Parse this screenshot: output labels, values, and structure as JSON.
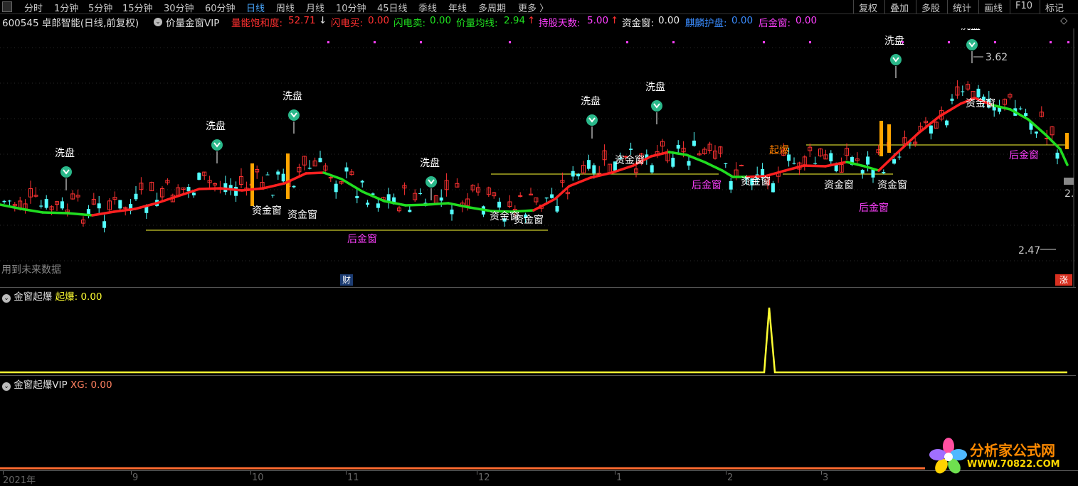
{
  "toolbar": {
    "periods": [
      "分时",
      "1分钟",
      "5分钟",
      "15分钟",
      "30分钟",
      "60分钟",
      "日线",
      "周线",
      "月线",
      "10分钟",
      "45日线",
      "季线",
      "年线",
      "多周期",
      "更多 〉"
    ],
    "active_period": "日线",
    "right_buttons": [
      "复权",
      "叠加",
      "多股",
      "统计",
      "画线",
      "F10",
      "标记"
    ]
  },
  "info_bar": {
    "stock": "600545 卓郎智能(日线,前复权)",
    "indicator": "价量金窗VIP",
    "saturation": {
      "label": "量能饱和度:",
      "value": "52.71",
      "arrow": "↓"
    },
    "flash_buy": {
      "label": "闪电买:",
      "value": "0.00"
    },
    "flash_sell": {
      "label": "闪电卖:",
      "value": "0.00"
    },
    "avg_line": {
      "label": "价量均线:",
      "value": "2.94",
      "arrow": "↑"
    },
    "hold_days": {
      "label": "持股天数:",
      "value": "5.00",
      "arrow": "↑"
    },
    "fund_window": {
      "label": "资金窗:",
      "value": "0.00"
    },
    "qilin": {
      "label": "麒麟护盘:",
      "value": "0.00"
    },
    "after_window": {
      "label": "后金窗:",
      "value": "0.00"
    }
  },
  "main_chart": {
    "labels": {
      "wash": "洗盘",
      "fund": "资金窗",
      "after": "后金窗",
      "burst": "起爆",
      "high_value": "3.62",
      "low_value": "2.47",
      "right_value": "2."
    },
    "future_note": "用到未来数据",
    "badge_finance": "财",
    "badge_rise": "涨"
  },
  "sub1": {
    "title": "金窗起爆",
    "series_label": "起爆:",
    "series_value": "0.00"
  },
  "sub2": {
    "title": "金窗起爆VIP",
    "series_label": "XG:",
    "series_value": "0.00"
  },
  "time_axis": [
    "2021年",
    "9",
    "10",
    "11",
    "12",
    "1",
    "2",
    "3"
  ],
  "watermark": {
    "title": "分析家公式网",
    "url": "WWW.70822.COM"
  },
  "colors": {
    "up": "#ff3232",
    "down": "#54ffff",
    "avg_up": "#ff2020",
    "avg_down": "#20dd20",
    "wash": "#ffffff",
    "fund_bar": "#ffa500",
    "after": "#ff40ff",
    "burst": "#ff8000",
    "signal": "#ffff33"
  }
}
